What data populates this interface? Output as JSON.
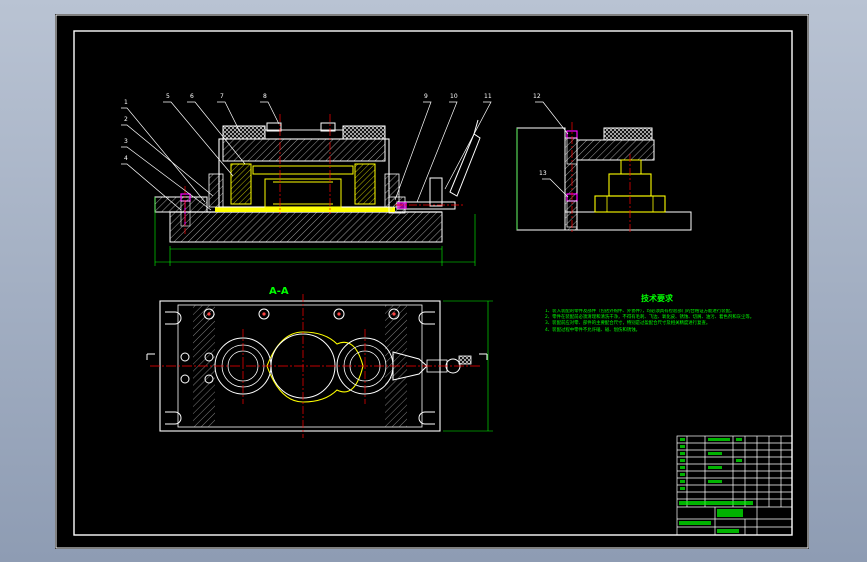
{
  "section_label": "A-A",
  "notes": {
    "title": "技术要求",
    "items": [
      "1、装入装配的零件及部件（包括外购件、外协件），均必须具有检验部门的合格证方能进行装配。",
      "2、零件在装配前必须清理和清洗干净，不得有毛刺、飞边、氧化皮、锈蚀、切屑、油污、着色剂和灰尘等。",
      "3、装配前应对零、部件的主要配合尺寸，特别是过盈配合尺寸及相关精度进行复查。",
      "4、装配过程中零件不允许磕、碰、划伤和锈蚀。"
    ]
  },
  "balloons": [
    "1",
    "2",
    "3",
    "4",
    "5",
    "6",
    "7",
    "8",
    "9",
    "10",
    "11",
    "12",
    "13"
  ],
  "colors": {
    "background": "#000000",
    "frame": "#ffffff",
    "outline": "#ffffff",
    "section_hatch": "#ffff00",
    "centerline": "#ff0000",
    "dimension": "#00ff00",
    "hidden_part": "#ff00ff",
    "notes_text": "#00ff00",
    "accent_yellow": "#ffff00"
  }
}
